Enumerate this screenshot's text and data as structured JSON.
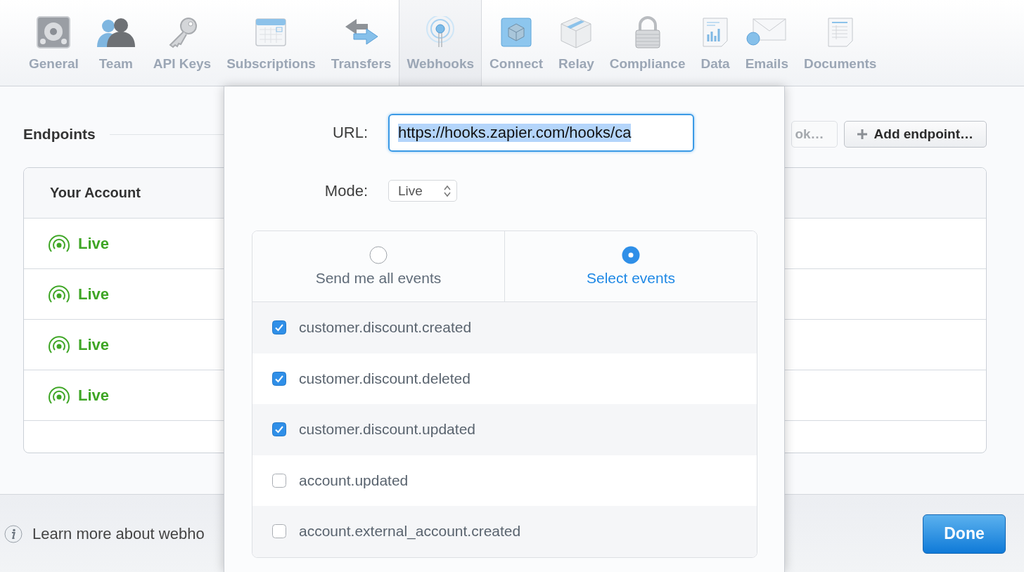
{
  "nav": {
    "tabs": [
      {
        "label": "General",
        "kind": "gear",
        "selected": false
      },
      {
        "label": "Team",
        "kind": "people",
        "selected": false
      },
      {
        "label": "API Keys",
        "kind": "key",
        "selected": false
      },
      {
        "label": "Subscriptions",
        "kind": "calendar",
        "selected": false
      },
      {
        "label": "Transfers",
        "kind": "arrows",
        "selected": false
      },
      {
        "label": "Webhooks",
        "kind": "antenna",
        "selected": true
      },
      {
        "label": "Connect",
        "kind": "cube",
        "selected": false
      },
      {
        "label": "Relay",
        "kind": "box",
        "selected": false
      },
      {
        "label": "Compliance",
        "kind": "lock",
        "selected": false
      },
      {
        "label": "Data",
        "kind": "chart",
        "selected": false
      },
      {
        "label": "Emails",
        "kind": "envelope",
        "selected": false
      },
      {
        "label": "Documents",
        "kind": "document",
        "selected": false
      }
    ]
  },
  "endpoints": {
    "title": "Endpoints",
    "buttons": [
      {
        "label": "ok…",
        "kind": "faded"
      },
      {
        "label": "Add endpoint…",
        "kind": "add"
      }
    ],
    "table": {
      "column": "Your Account",
      "rows": [
        {
          "status": "Live"
        },
        {
          "status": "Live"
        },
        {
          "status": "Live"
        },
        {
          "status": "Live"
        }
      ]
    }
  },
  "footer": {
    "help_text": "Learn more about webho",
    "done_button": "Done"
  },
  "dialog": {
    "url_label": "URL:",
    "url_value": "https://hooks.zapier.com/hooks/ca",
    "mode_label": "Mode:",
    "mode_value": "Live",
    "options": [
      {
        "label": "Send me all events",
        "selected": false
      },
      {
        "label": "Select events",
        "selected": true
      }
    ],
    "events": [
      {
        "name": "customer.discount.created",
        "checked": true
      },
      {
        "name": "customer.discount.deleted",
        "checked": true
      },
      {
        "name": "customer.discount.updated",
        "checked": true
      },
      {
        "name": "account.updated",
        "checked": false
      },
      {
        "name": "account.external_account.created",
        "checked": false
      }
    ]
  }
}
